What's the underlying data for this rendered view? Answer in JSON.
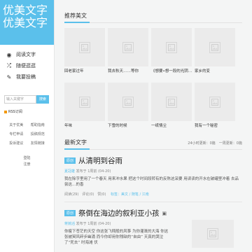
{
  "site": {
    "logo": "优美文字优美文字"
  },
  "nav": [
    {
      "label": "阅读文字",
      "icon": "eye-icon"
    },
    {
      "label": "随便逛逛",
      "icon": "shuffle-icon"
    },
    {
      "label": "我要投稿",
      "icon": "pencil-icon"
    }
  ],
  "search": {
    "placeholder": "输入关键字",
    "button": "搜索"
  },
  "rss": {
    "label": "RSS订阅"
  },
  "links": [
    "关于优美",
    "帮助指南",
    "专栏申请",
    "投稿规范",
    "投诉建议",
    "友情链接"
  ],
  "auth": {
    "login": "登陆",
    "register": "注册"
  },
  "recommend": {
    "title": "推荐美文",
    "items": [
      {
        "caption": "回老家过年"
      },
      {
        "caption": "我去秋天……等你"
      },
      {
        "caption": "《想要•想一段的光阴……"
      },
      {
        "caption": "家乡的变"
      },
      {
        "caption": "年味"
      },
      {
        "caption": "下雪的时候"
      },
      {
        "caption": "一纸情尘"
      },
      {
        "caption": "我有一个秘密"
      }
    ]
  },
  "latest": {
    "title": "最新文字",
    "stats": "24小时更新：0篇　一周更新：0篇",
    "posts": [
      {
        "tag": "原创",
        "title": "从清明到谷雨",
        "author": "夏冠雄",
        "date": "发布于 1周前 (04-20)",
        "excerpt": "我在除字里用了一个春天 用来冲水果 把这个时间段转有的反陈这采要 用读读的开水在破罐里冲着 去品尝这…的香",
        "acts": "阅读(29)　评论(0)　赞(0)　",
        "links": "标签：美文 / 随笔 / 江南"
      },
      {
        "tag": "原创",
        "title": "祭倒在海边的叙利亚小孩",
        "author": "蒋婉滔",
        "date": "发布于 1周前 (04-20)",
        "excerpt": "你瘦下苍茫的天空 你这张飞翔般的风筝 为你灌溉的大海 你这张被冥风碎步幽涌 而今你却用你残缺的“自由” 天真的哭泣了“死去” 时海滩 伏"
      }
    ]
  }
}
